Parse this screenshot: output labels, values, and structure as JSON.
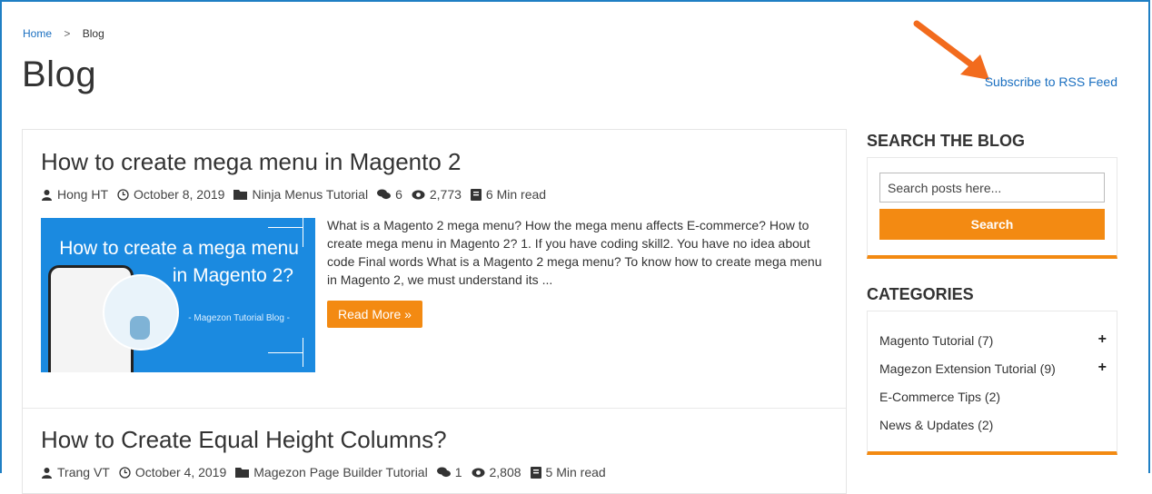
{
  "breadcrumb": {
    "home": "Home",
    "separator": ">",
    "current": "Blog"
  },
  "page_title": "Blog",
  "rss_link": "Subscribe to RSS Feed",
  "colors": {
    "accent": "#f38a12",
    "link": "#1a6fc0",
    "frame": "#1f7fc4"
  },
  "posts": [
    {
      "title": "How to create mega menu in Magento 2",
      "author": "Hong HT",
      "date": "October 8, 2019",
      "category": "Ninja Menus Tutorial",
      "comments": "6",
      "views": "2,773",
      "read_time": "6 Min read",
      "thumb_line1": "How to create a mega menu",
      "thumb_line2": "in Magento 2?",
      "thumb_caption": "- Magezon Tutorial Blog -",
      "excerpt": "What is a Magento 2 mega menu? How the mega menu affects E-commerce? How to create mega menu in Magento 2? 1. If you have coding skill2. You have no idea about code Final words What is a Magento 2 mega menu? To know how to create mega menu in Magento 2, we must understand its ...",
      "read_more": "Read More »"
    },
    {
      "title": "How to Create Equal Height Columns?",
      "author": "Trang VT",
      "date": "October 4, 2019",
      "category": "Magezon Page Builder Tutorial",
      "comments": "1",
      "views": "2,808",
      "read_time": "5 Min read"
    }
  ],
  "sidebar": {
    "search": {
      "heading": "SEARCH THE BLOG",
      "placeholder": "Search posts here...",
      "button": "Search"
    },
    "categories": {
      "heading": "CATEGORIES",
      "items": [
        {
          "label": "Magento Tutorial (7)",
          "expand": "+"
        },
        {
          "label": "Magezon Extension Tutorial (9)",
          "expand": "+"
        },
        {
          "label": "E-Commerce Tips (2)",
          "expand": ""
        },
        {
          "label": "News & Updates (2)",
          "expand": ""
        }
      ]
    }
  }
}
